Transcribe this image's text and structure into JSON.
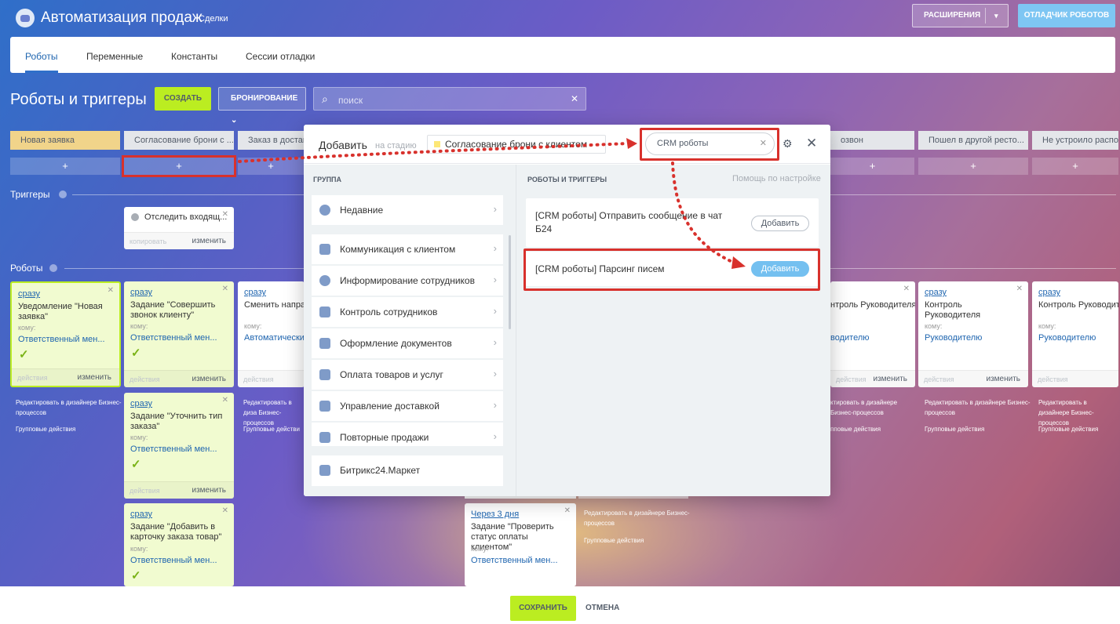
{
  "header": {
    "app_title": "Автоматизация продаж",
    "app_subtitle": "Сделки",
    "extensions_label": "РАСШИРЕНИЯ",
    "debugger_label": "ОТЛАДЧИК РОБОТОВ"
  },
  "tabs": [
    {
      "label": "Роботы",
      "active": true
    },
    {
      "label": "Переменные"
    },
    {
      "label": "Константы"
    },
    {
      "label": "Сессии отладки"
    }
  ],
  "toolbar": {
    "title": "Роботы и триггеры",
    "create_label": "СОЗДАТЬ",
    "booking_label": "БРОНИРОВАНИЕ",
    "search_placeholder": "поиск"
  },
  "stages": [
    "Новая заявка",
    "Согласование брони с ...",
    "Заказ в доставк",
    "",
    "",
    "",
    "",
    "озвон",
    "Пошел в другой ресто...",
    "Не устроило распол"
  ],
  "sections": {
    "triggers": "Триггеры",
    "robots": "Роботы"
  },
  "trigger_card": {
    "title": "Отследить входящ...",
    "copy": "копировать",
    "edit": "изменить"
  },
  "cards": {
    "c1": {
      "when": "сразу",
      "title": "Уведомление \"Новая заявка\"",
      "to": "кому:",
      "resp": "Ответственный мен...",
      "actions": "действия",
      "edit": "изменить"
    },
    "c2": {
      "when": "сразу",
      "title": "Задание \"Совершить звонок клиенту\"",
      "to": "кому:",
      "resp": "Ответственный мен...",
      "actions": "действия",
      "edit": "изменить"
    },
    "c3": {
      "when": "сразу",
      "title": "Сменить напра",
      "to": "кому:",
      "resp": "Автоматически",
      "actions": "действия"
    },
    "c4": {
      "when": "сразу",
      "title": "Задание \"Уточнить тип заказа\"",
      "to": "кому:",
      "resp": "Ответственный мен...",
      "actions": "действия",
      "edit": "изменить"
    },
    "c5": {
      "when": "сразу",
      "title": "Задание \"Добавить в карточку заказа товар\"",
      "to": "кому:",
      "resp": "Ответственный мен..."
    },
    "c6": {
      "when": "Через 3 дня",
      "title": "Задание \"Проверить статус оплаты клиентом\"",
      "to": "кому:",
      "resp": "Ответственный мен..."
    },
    "c7": {
      "title": "нтроль Руководителя",
      "resp": "водителю",
      "actions": "действия",
      "edit": "изменить"
    },
    "c8": {
      "when": "сразу",
      "title": "Контроль Руководителя",
      "to": "кому:",
      "resp": "Руководителю",
      "actions": "действия",
      "edit": "изменить"
    },
    "c9": {
      "when": "сразу",
      "title": "Контроль Руководите",
      "to": "кому:",
      "resp": "Руководителю",
      "actions": "действия"
    }
  },
  "links": {
    "designer": "Редактировать в дизайнере Бизнес-процессов",
    "group": "Групповые действия",
    "designer_short": "Редактировать в диза Бизнес-процессов",
    "group_short": "Групповые действи",
    "designer_cut": "ктировать в дизайнере Бизнес-процессов",
    "group_cut": "пповые действия"
  },
  "modal": {
    "title": "Добавить",
    "stage_prefix": "на стадию",
    "stage_value": "Согласование брони с клиентом",
    "search_value": "CRM роботы",
    "group_label": "ГРУППА",
    "robots_label": "РОБОТЫ И ТРИГГЕРЫ",
    "help_link": "Помощь по настройке",
    "groups": [
      "Недавние",
      "Коммуникация с клиентом",
      "Информирование сотрудников",
      "Контроль сотрудников",
      "Оформление документов",
      "Оплата товаров и услуг",
      "Управление доставкой",
      "Повторные продажи"
    ],
    "market": "Битрикс24.Маркет",
    "results": [
      {
        "title": "[CRM роботы] Отправить сообщение в чат Б24",
        "button": "Добавить"
      },
      {
        "title": "[CRM роботы] Парсинг писем",
        "button": "Добавить"
      }
    ]
  },
  "footer": {
    "save": "СОХРАНИТЬ",
    "cancel": "ОТМЕНА"
  },
  "colors": {
    "accent_green": "#bbed21",
    "accent_blue": "#7ec6f3",
    "highlight_red": "#d8312c",
    "stage_first": "#f1d48a"
  }
}
